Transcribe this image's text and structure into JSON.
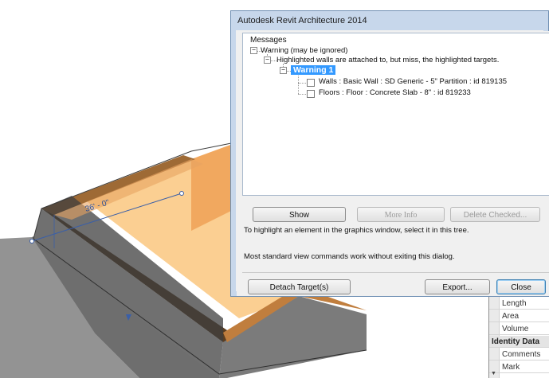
{
  "viewport": {
    "dimension_label": "36' - 0\"",
    "colors": {
      "wall_face": "#f5b57a",
      "wall_top": "#b07a3f",
      "floor": "#fbcf92",
      "shadow": "#7f7f7f",
      "highlight": "#3a5fa8"
    }
  },
  "properties": {
    "rows": [
      {
        "label": "Length",
        "header": false
      },
      {
        "label": "Area",
        "header": false
      },
      {
        "label": "Volume",
        "header": false
      },
      {
        "label": "Identity Data",
        "header": true
      },
      {
        "label": "Comments",
        "header": false
      },
      {
        "label": "Mark",
        "header": false
      }
    ]
  },
  "dialog": {
    "title": "Autodesk Revit Architecture 2014",
    "messages_label": "Messages",
    "tree": {
      "root": "Warning (may be ignored)",
      "child": "Highlighted walls are attached to, but miss, the highlighted targets.",
      "selected": "Warning 1",
      "items": [
        "Walls : Basic Wall : SD Generic -  5\" Partition : id 819135",
        "Floors : Floor : Concrete Slab - 8\" : id 819233"
      ]
    },
    "buttons": {
      "show": "Show",
      "more_info": "More Info",
      "delete_checked": "Delete Checked...",
      "detach": "Detach Target(s)",
      "export": "Export...",
      "close": "Close"
    },
    "hint1": "To highlight an element in the graphics window, select it in this tree.",
    "hint2": "Most standard view commands work without exiting this dialog."
  }
}
